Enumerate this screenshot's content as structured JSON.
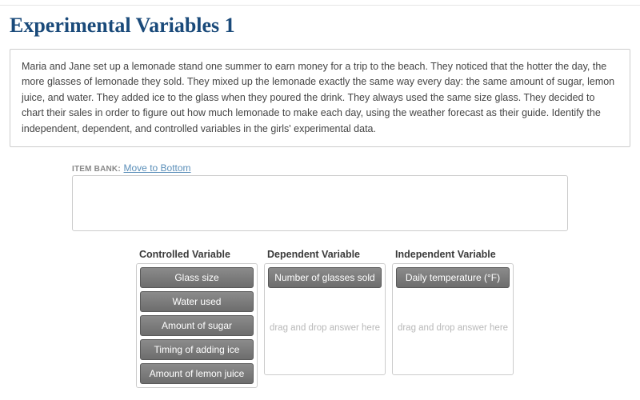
{
  "title": "Experimental Variables 1",
  "passage": "Maria and Jane set up a lemonade stand one summer to earn money for a trip to the beach. They noticed that the hotter the day, the more glasses of lemonade they sold. They mixed up the lemonade exactly the same way every day: the same amount of sugar, lemon juice, and water. They added ice to the glass when they poured the drink. They always used the same size glass. They decided to chart their sales in order to figure out how much lemonade to make each day, using the weather forecast as their guide. Identify the independent, dependent, and controlled variables in the girls' experimental data.",
  "bank": {
    "label": "ITEM BANK:",
    "link": "Move to Bottom"
  },
  "columns": [
    {
      "heading": "Controlled Variable",
      "chips": [
        "Glass size",
        "Water used",
        "Amount of sugar",
        "Timing of adding ice",
        "Amount of lemon juice"
      ],
      "placeholder": ""
    },
    {
      "heading": "Dependent Variable",
      "chips": [
        "Number of glasses sold"
      ],
      "placeholder": "drag and drop answer here"
    },
    {
      "heading": "Independent Variable",
      "chips": [
        "Daily temperature (°F)"
      ],
      "placeholder": "drag and drop answer here"
    }
  ]
}
